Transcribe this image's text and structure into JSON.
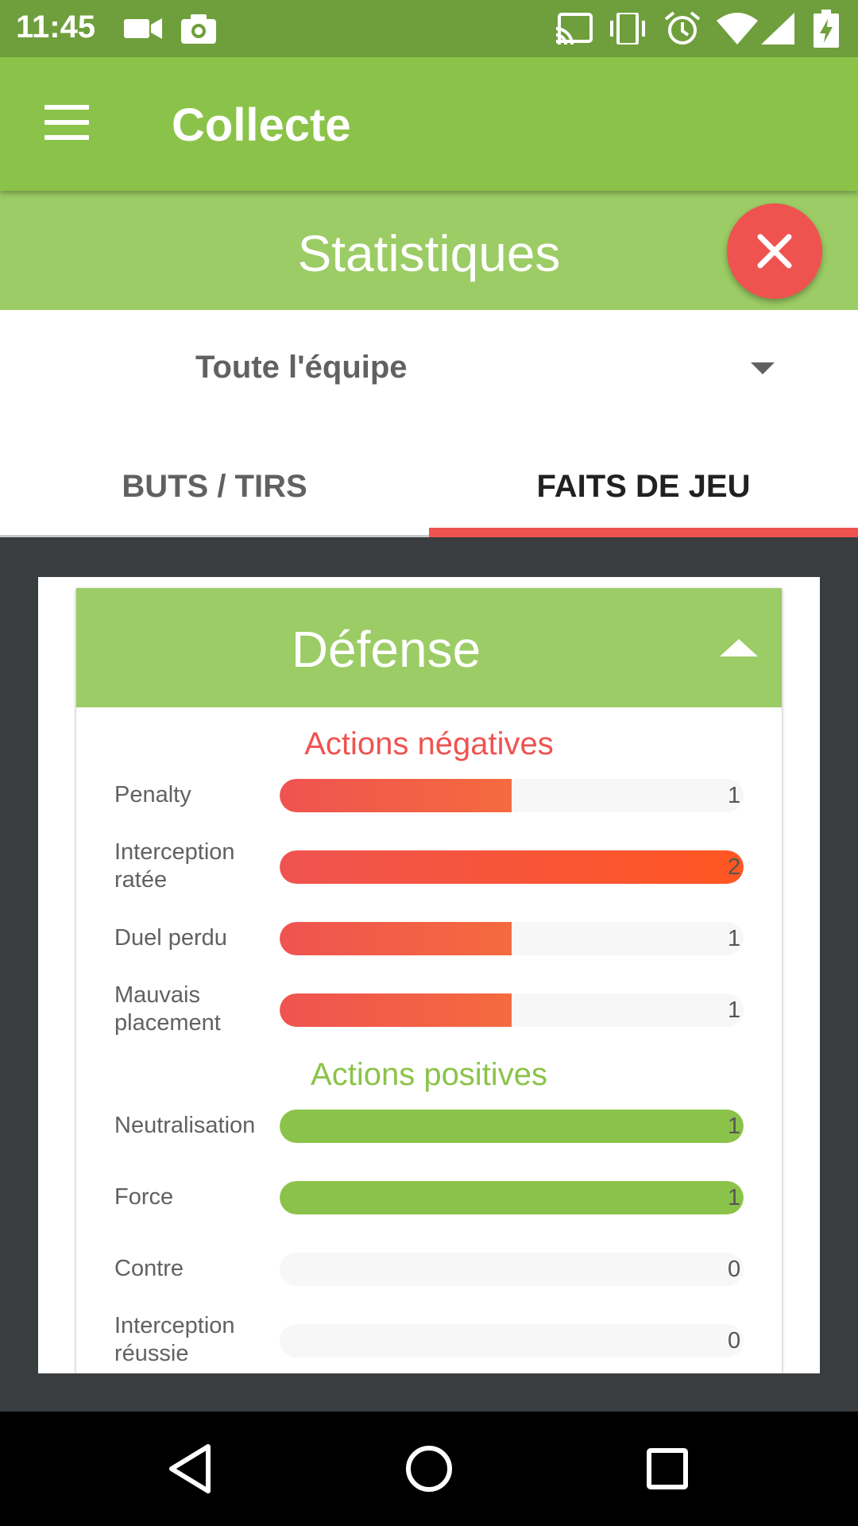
{
  "status_bar": {
    "time": "11:45",
    "left_icons": [
      "video-camera-icon",
      "camera-icon"
    ],
    "right_icons": [
      "cast-icon",
      "vibrate-icon",
      "alarm-icon",
      "wifi-icon",
      "signal-icon",
      "battery-charging-icon"
    ]
  },
  "app_bar": {
    "title": "Collecte",
    "menu_icon": "menu-icon"
  },
  "stats_header": {
    "title": "Statistiques",
    "close_icon": "close-icon"
  },
  "team_filter": {
    "selected": "Toute l'équipe"
  },
  "tabs": [
    {
      "label": "BUTS / TIRS",
      "active": false
    },
    {
      "label": "FAITS DE JEU",
      "active": true
    }
  ],
  "section": {
    "title": "Défense",
    "negative": {
      "heading": "Actions négatives",
      "rows": [
        {
          "label": "Penalty",
          "value": "1",
          "fill": 0.5
        },
        {
          "label": "Interception ratée",
          "value": "2",
          "fill": 1.0
        },
        {
          "label": "Duel perdu",
          "value": "1",
          "fill": 0.5
        },
        {
          "label": "Mauvais placement",
          "value": "1",
          "fill": 0.5
        }
      ]
    },
    "positive": {
      "heading": "Actions positives",
      "rows": [
        {
          "label": "Neutralisation",
          "value": "1",
          "fill": 1.0
        },
        {
          "label": "Force",
          "value": "1",
          "fill": 1.0
        },
        {
          "label": "Contre",
          "value": "0",
          "fill": 0
        },
        {
          "label": "Interception réussie",
          "value": "0",
          "fill": 0
        }
      ]
    }
  },
  "colors": {
    "primary": "#8bc34a",
    "primary_light": "#9ccc65",
    "status_bar": "#6f9f3c",
    "accent": "#ef5350",
    "negative_end": "#ff5722"
  },
  "nav_bar": {
    "icons": [
      "back-icon",
      "home-icon",
      "recents-icon"
    ]
  }
}
